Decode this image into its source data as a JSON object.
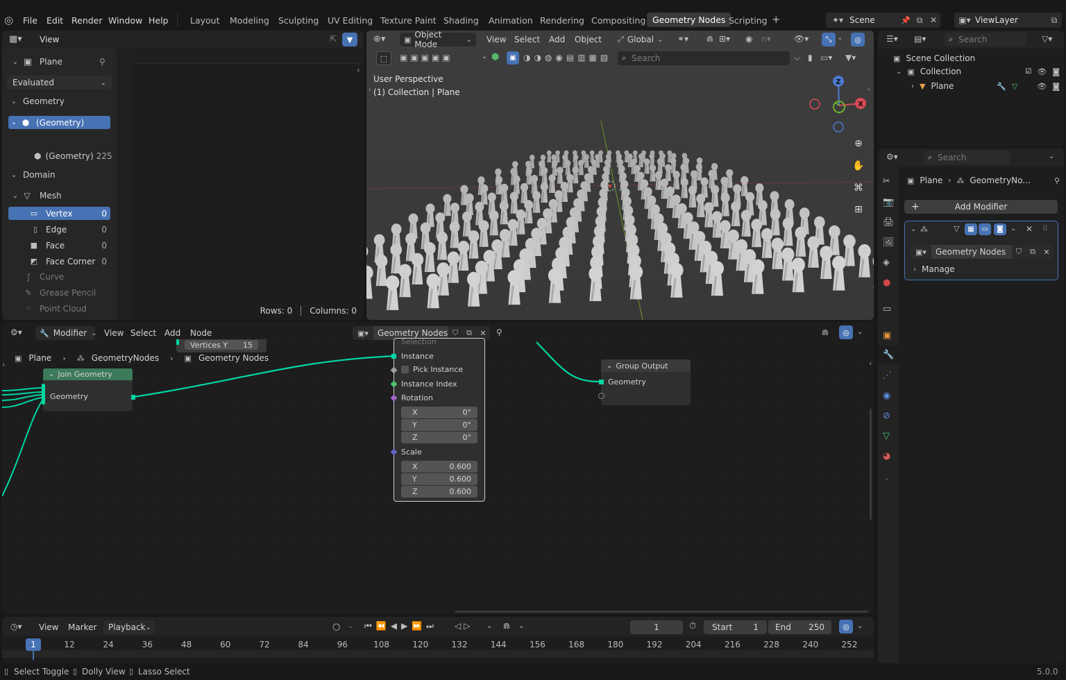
{
  "topbar": {
    "menus": [
      "File",
      "Edit",
      "Render",
      "Window",
      "Help"
    ],
    "workspaces": [
      "Layout",
      "Modeling",
      "Sculpting",
      "UV Editing",
      "Texture Paint",
      "Shading",
      "Animation",
      "Rendering",
      "Compositing",
      "Geometry Nodes",
      "Scripting"
    ],
    "active_workspace": "Geometry Nodes",
    "add_symbol": "+",
    "scene": "Scene",
    "view_layer": "ViewLayer"
  },
  "spreadsheet": {
    "view_menu": "View",
    "object": "Plane",
    "eval_mode": "Evaluated",
    "geometry_label": "Geometry",
    "geo_item": "(Geometry)",
    "geo_sub": "(Geometry)",
    "geo_sub_count": "225",
    "domain_label": "Domain",
    "mesh_label": "Mesh",
    "domains": [
      {
        "label": "Vertex",
        "count": "0"
      },
      {
        "label": "Edge",
        "count": "0"
      },
      {
        "label": "Face",
        "count": "0"
      },
      {
        "label": "Face Corner",
        "count": "0"
      }
    ],
    "other": [
      "Curve",
      "Grease Pencil",
      "Point Cloud"
    ],
    "rows": "Rows: 0",
    "columns": "Columns: 0"
  },
  "viewport": {
    "mode": "Object Mode",
    "menus": [
      "View",
      "Select",
      "Add",
      "Object"
    ],
    "orientation": "Global",
    "search_placeholder": "Search",
    "perspective": "User Perspective",
    "collection_info": "(1) Collection | Plane",
    "gizmo": {
      "z": "Z",
      "x": "X"
    }
  },
  "outliner": {
    "search_placeholder": "Search",
    "scene_collection": "Scene Collection",
    "collection": "Collection",
    "object": "Plane"
  },
  "properties": {
    "search_placeholder": "Search",
    "breadcrumb_obj": "Plane",
    "breadcrumb_mod": "GeometryNo...",
    "add_modifier": "Add Modifier",
    "node_group": "Geometry Nodes",
    "manage": "Manage"
  },
  "node_editor": {
    "editor_type": "Modifier",
    "menus": [
      "View",
      "Select",
      "Add",
      "Node"
    ],
    "tree_name": "Geometry Nodes",
    "breadcrumb": [
      "Plane",
      "GeometryNodes",
      "Geometry Nodes"
    ],
    "grid_partial": {
      "label": "Vertices Y",
      "value": "15"
    },
    "join": {
      "title": "Join Geometry",
      "socket": "Geometry"
    },
    "instance": {
      "cut": "Selection",
      "instance": "Instance",
      "pick": "Pick Instance",
      "index": "Instance Index",
      "rotation": "Rotation",
      "rot": [
        {
          "axis": "X",
          "value": "0°"
        },
        {
          "axis": "Y",
          "value": "0°"
        },
        {
          "axis": "Z",
          "value": "0°"
        }
      ],
      "scale": "Scale",
      "scl": [
        {
          "axis": "X",
          "value": "0.600"
        },
        {
          "axis": "Y",
          "value": "0.600"
        },
        {
          "axis": "Z",
          "value": "0.600"
        }
      ]
    },
    "output": {
      "title": "Group Output",
      "socket": "Geometry"
    }
  },
  "timeline": {
    "menus": [
      "View",
      "Marker"
    ],
    "playback": "Playback",
    "frame": "1",
    "start_label": "Start",
    "start": "1",
    "end_label": "End",
    "end": "250",
    "current": "1",
    "ticks": [
      "12",
      "24",
      "36",
      "48",
      "60",
      "72",
      "84",
      "96",
      "108",
      "120",
      "132",
      "144",
      "156",
      "168",
      "180",
      "192",
      "204",
      "216",
      "228",
      "240",
      "252"
    ]
  },
  "status": {
    "items": [
      "Select Toggle",
      "Dolly View",
      "Lasso Select"
    ],
    "version": "5.0.0"
  },
  "colors": {
    "accent": "#4772b3",
    "geometry_socket": "#00d6a3",
    "node_join_header": "#3c7a5a",
    "vector_socket": "#6363c7"
  }
}
